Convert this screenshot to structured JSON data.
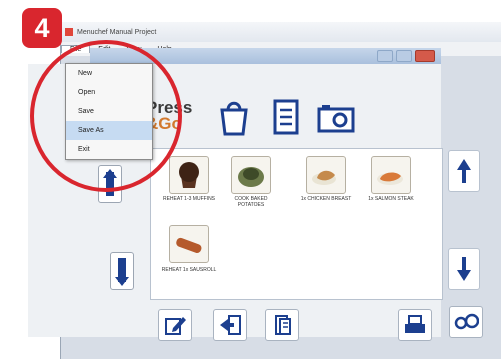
{
  "step_badge": "4",
  "window": {
    "title": "Menuchef Manual Project",
    "menu": [
      "File",
      "Edit",
      "View",
      "Help"
    ]
  },
  "file_menu": {
    "items": [
      "New",
      "Open",
      "Save",
      "Save As",
      "Exit"
    ],
    "highlighted": "Save As"
  },
  "logo": {
    "line1": "Press",
    "line2": "&Go"
  },
  "tiles": [
    {
      "label": "REHEAT 1-3 MUFFINS",
      "icon": "muffin-icon"
    },
    {
      "label": "COOK BAKED POTATOES",
      "icon": "potato-icon"
    },
    {
      "label": "1x CHICKEN BREAST",
      "icon": "chicken-breast-icon"
    },
    {
      "label": "1x SALMON STEAK",
      "icon": "salmon-icon"
    },
    {
      "label": "REHEAT 1x SAUSROLL",
      "icon": "sausage-roll-icon"
    }
  ],
  "colors": {
    "accent": "#d9262e",
    "primary_blue": "#1c3f8f",
    "logo_orange": "#d2792e"
  },
  "icons": [
    "bag-icon",
    "document-icon",
    "camera-icon",
    "arrow-up-icon",
    "arrow-down-icon",
    "edit-icon",
    "import-icon",
    "export-icon",
    "print-icon",
    "settings-icon"
  ]
}
